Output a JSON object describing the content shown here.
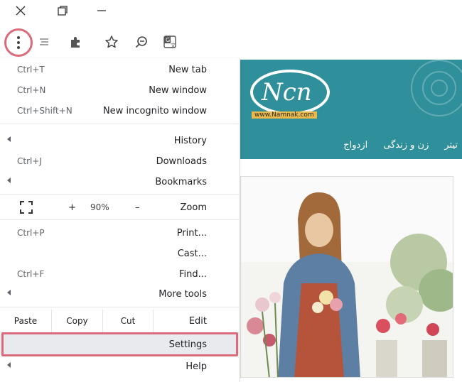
{
  "titlebar": {
    "close_icon": "close-icon",
    "restore_icon": "restore-icon",
    "minimize_icon": "minimize-icon"
  },
  "toolbar": {
    "icons": [
      "menu-dots-icon",
      "reading-list-icon",
      "extensions-icon",
      "bookmark-star-icon",
      "zoom-out-icon",
      "translate-icon"
    ]
  },
  "page": {
    "logo_text": "Ncn",
    "logo_url": "www.Namnak.com",
    "nav": [
      "ازدواج",
      "زن و زندگی",
      "تیتر"
    ]
  },
  "menu": {
    "new_tab": {
      "label": "New tab",
      "shortcut": "Ctrl+T"
    },
    "new_window": {
      "label": "New window",
      "shortcut": "Ctrl+N"
    },
    "new_incognito": {
      "label": "New incognito window",
      "shortcut": "Ctrl+Shift+N"
    },
    "history": {
      "label": "History"
    },
    "downloads": {
      "label": "Downloads",
      "shortcut": "Ctrl+J"
    },
    "bookmarks": {
      "label": "Bookmarks"
    },
    "zoom": {
      "label": "Zoom",
      "minus": "–",
      "value": "90%",
      "plus": "+"
    },
    "print": {
      "label": "Print...",
      "shortcut": "Ctrl+P"
    },
    "cast": {
      "label": "Cast..."
    },
    "find": {
      "label": "Find...",
      "shortcut": "Ctrl+F"
    },
    "more_tools": {
      "label": "More tools"
    },
    "edit": {
      "label": "Edit",
      "cut": "Cut",
      "copy": "Copy",
      "paste": "Paste"
    },
    "settings": {
      "label": "Settings"
    },
    "help": {
      "label": "Help"
    }
  },
  "colors": {
    "highlight": "#d96b7a",
    "banner": "#2f8f9b"
  }
}
